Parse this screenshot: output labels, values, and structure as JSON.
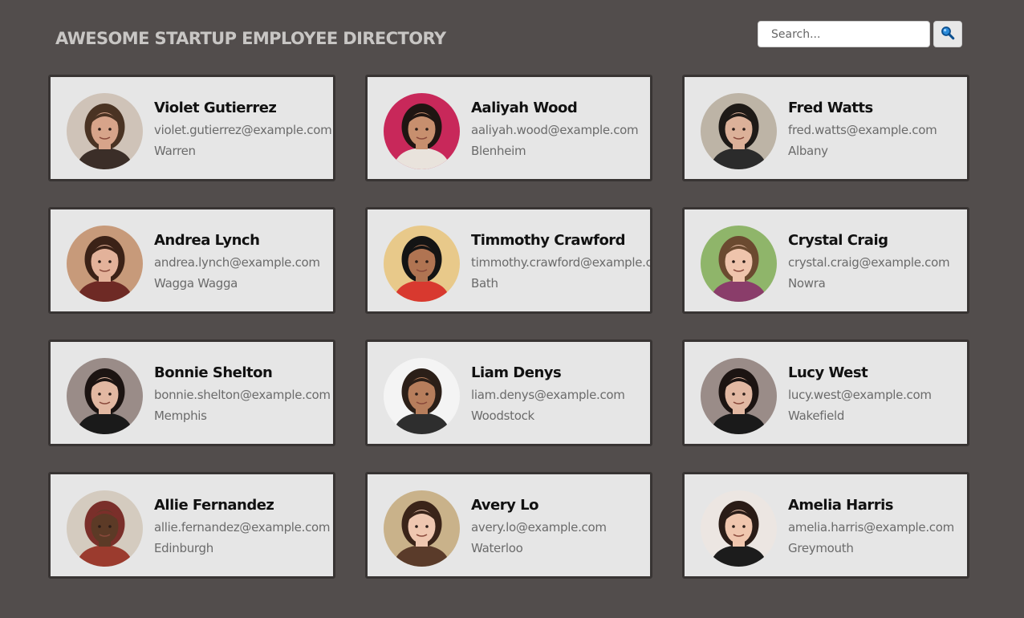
{
  "header": {
    "title": "AWESOME STARTUP EMPLOYEE DIRECTORY"
  },
  "search": {
    "placeholder": "Search...",
    "button_icon": "search-icon"
  },
  "employees": [
    {
      "name": "Violet Gutierrez",
      "email": "violet.gutierrez@example.com",
      "city": "Warren",
      "avatar": {
        "bg": "#cfc3b8",
        "hair": "#4a3323",
        "skin": "#d7a48a",
        "shirt": "#3b2e28"
      }
    },
    {
      "name": "Aaliyah Wood",
      "email": "aaliyah.wood@example.com",
      "city": "Blenheim",
      "avatar": {
        "bg": "#c8285a",
        "hair": "#1f1512",
        "skin": "#c78f6e",
        "shirt": "#e9e3dc"
      }
    },
    {
      "name": "Fred Watts",
      "email": "fred.watts@example.com",
      "city": "Albany",
      "avatar": {
        "bg": "#bdb4a6",
        "hair": "#1e1a17",
        "skin": "#dcb199",
        "shirt": "#2b2b2b"
      }
    },
    {
      "name": "Andrea Lynch",
      "email": "andrea.lynch@example.com",
      "city": "Wagga Wagga",
      "avatar": {
        "bg": "#c79a7a",
        "hair": "#3b2217",
        "skin": "#e3b29a",
        "shirt": "#6e2a25"
      }
    },
    {
      "name": "Timmothy Crawford",
      "email": "timmothy.crawford@example.com",
      "city": "Bath",
      "avatar": {
        "bg": "#e8c98a",
        "hair": "#141414",
        "skin": "#b07452",
        "shirt": "#d8392f"
      }
    },
    {
      "name": "Crystal Craig",
      "email": "crystal.craig@example.com",
      "city": "Nowra",
      "avatar": {
        "bg": "#8fb56a",
        "hair": "#6b4a30",
        "skin": "#efc4ac",
        "shirt": "#8a3d6a"
      }
    },
    {
      "name": "Bonnie Shelton",
      "email": "bonnie.shelton@example.com",
      "city": "Memphis",
      "avatar": {
        "bg": "#9a8c88",
        "hair": "#1c1412",
        "skin": "#e2b8a2",
        "shirt": "#1a1a1a"
      }
    },
    {
      "name": "Liam Denys",
      "email": "liam.denys@example.com",
      "city": "Woodstock",
      "avatar": {
        "bg": "#f4f4f4",
        "hair": "#2b1f18",
        "skin": "#b77e5c",
        "shirt": "#2e2e2e"
      }
    },
    {
      "name": "Lucy West",
      "email": "lucy.west@example.com",
      "city": "Wakefield",
      "avatar": {
        "bg": "#9a8c88",
        "hair": "#1c1412",
        "skin": "#e2b8a2",
        "shirt": "#1a1a1a"
      }
    },
    {
      "name": "Allie Fernandez",
      "email": "allie.fernandez@example.com",
      "city": "Edinburgh",
      "avatar": {
        "bg": "#d4cbbf",
        "hair": "#7a2f2a",
        "skin": "#5c3a26",
        "shirt": "#9b3b2e"
      }
    },
    {
      "name": "Avery Lo",
      "email": "avery.lo@example.com",
      "city": "Waterloo",
      "avatar": {
        "bg": "#c9b28a",
        "hair": "#3a2419",
        "skin": "#efc7b0",
        "shirt": "#5a3b2a"
      }
    },
    {
      "name": "Amelia Harris",
      "email": "amelia.harris@example.com",
      "city": "Greymouth",
      "avatar": {
        "bg": "#ece6e2",
        "hair": "#2a1c17",
        "skin": "#f0c6ae",
        "shirt": "#1c1c1c"
      }
    }
  ]
}
